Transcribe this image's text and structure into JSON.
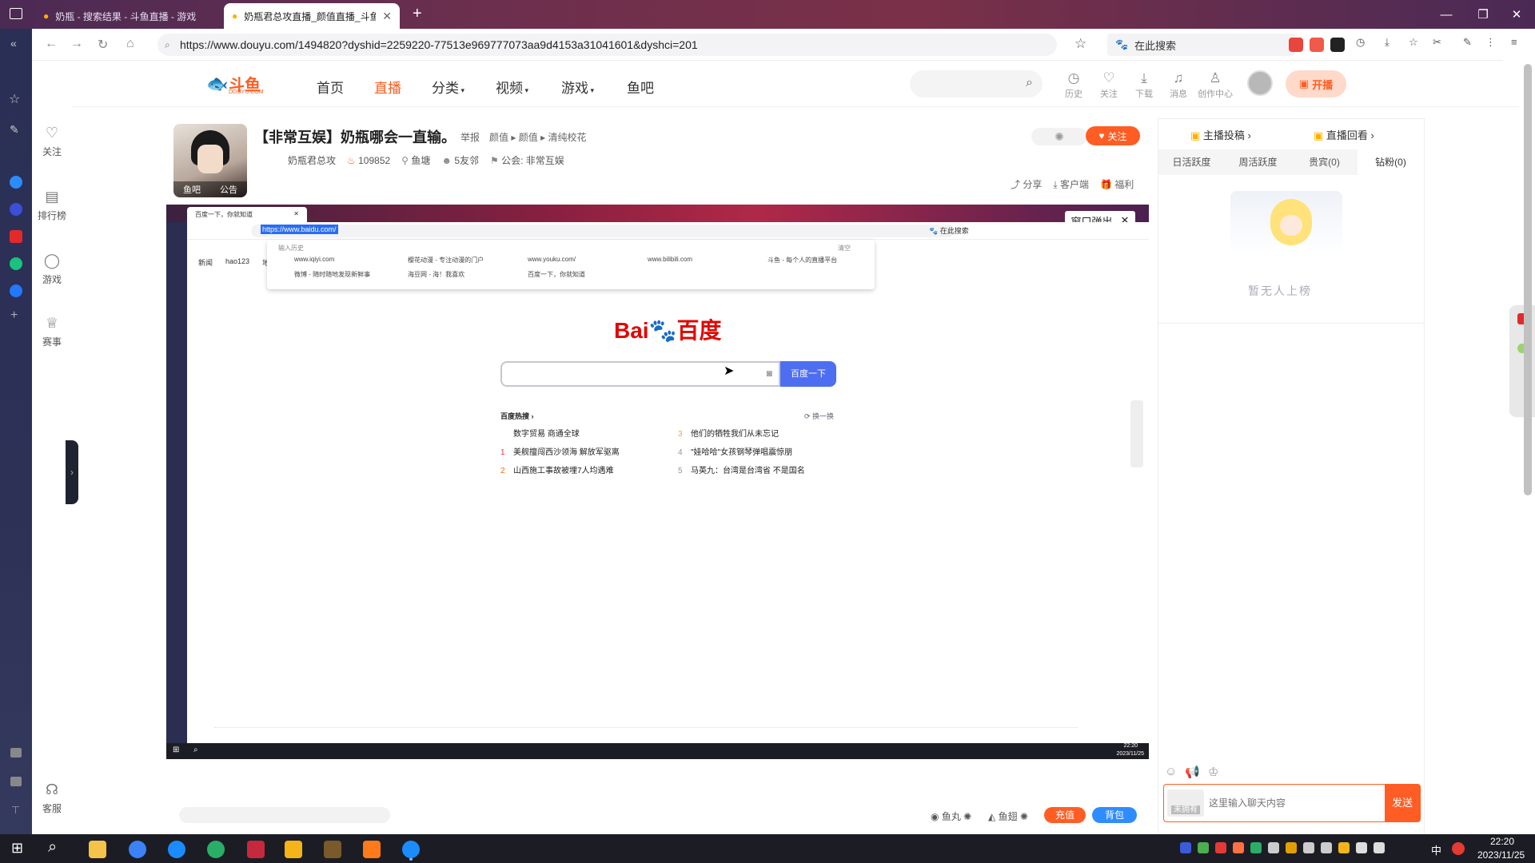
{
  "browser": {
    "tabs": [
      {
        "title": "奶瓶 - 搜索结果 - 斗鱼直播 - 游戏"
      },
      {
        "title": "奶瓶君总攻直播_颜值直播_斗鱼"
      }
    ],
    "url": "https://www.douyu.com/1494820?dyshid=2259220-77513e969777073aa9d4153a31041601&dyshci=201",
    "search_placeholder": "在此搜索"
  },
  "douyu": {
    "logo_text": "斗鱼",
    "logo_sub": "DOUYU.COM",
    "menu": [
      {
        "label": "首页",
        "active": false
      },
      {
        "label": "直播",
        "active": true
      },
      {
        "label": "分类",
        "dropdown": true
      },
      {
        "label": "视频",
        "dropdown": true
      },
      {
        "label": "游戏",
        "dropdown": true
      },
      {
        "label": "鱼吧",
        "active": false
      }
    ],
    "header_icons": [
      {
        "label": "历史",
        "icon": "clock-icon"
      },
      {
        "label": "关注",
        "icon": "heart-icon"
      },
      {
        "label": "下载",
        "icon": "download-icon"
      },
      {
        "label": "消息",
        "icon": "bell-icon"
      },
      {
        "label": "创作中心",
        "icon": "bulb-icon"
      }
    ],
    "start_live": "开播",
    "sidenav": [
      {
        "label": "关注",
        "icon": "heart-icon"
      },
      {
        "label": "排行榜",
        "icon": "rank-icon"
      },
      {
        "label": "游戏",
        "icon": "game-icon"
      },
      {
        "label": "赛事",
        "icon": "trophy-icon"
      },
      {
        "label": "客服",
        "icon": "headset-icon"
      }
    ],
    "room": {
      "title": "【非常互娱】奶瓶哪会一直输。",
      "report": "举报",
      "breadcrumb": [
        "颜值",
        "颜值",
        "清纯校花"
      ],
      "anchor": "奶瓶君总攻",
      "hot": "109852",
      "location": "鱼塘",
      "friends": "5友邻",
      "guild_label": "公会:",
      "guild": "非常互娱",
      "avatar_tabs": [
        "鱼吧",
        "公告"
      ],
      "follow": "关注",
      "actions": [
        "分享",
        "客户端",
        "福利"
      ]
    },
    "player": {
      "popup": "窗口弹出",
      "inner_tab": "百度一下，你就知道",
      "inner_url": "https://www.baidu.com/",
      "inner_search": "在此搜索",
      "history_label": "输入历史",
      "clear_label": "清空",
      "history": [
        "www.iqiyi.com",
        "樱花动漫 - 专注动漫的门户",
        "www.youku.com/",
        "www.bilibili.com",
        "斗鱼 - 每个人的直播平台",
        "微博 - 随时随地发现新鲜事",
        "海豆网 - 海！我喜欢",
        "百度一下，你就知道"
      ],
      "baidu_btn": "百度一下",
      "hot_title": "百度热搜",
      "hot_refresh": "换一换",
      "hot_left": [
        {
          "rank": "",
          "text": "数字贸易 商通全球"
        },
        {
          "rank": "1",
          "text": "美舰擅闯西沙领海 解放军驱离"
        },
        {
          "rank": "2",
          "text": "山西施工事故被埋7人均遇难"
        }
      ],
      "hot_right": [
        {
          "rank": "3",
          "text": "他们的牺牲我们从未忘记"
        },
        {
          "rank": "4",
          "text": "\"娃哈哈\"女孩钢琴弹唱震惊朋"
        },
        {
          "rank": "5",
          "text": "马英九：台湾是台湾省 不是国名"
        }
      ],
      "inner_nav": [
        "新闻",
        "hao123",
        "地"
      ],
      "inner_clock_time": "22:20",
      "inner_clock_date": "2023/11/25"
    },
    "footer": {
      "fishball": "鱼丸",
      "fishfin": "鱼翅",
      "recharge": "充值",
      "backpack": "背包"
    },
    "panel": {
      "top_links": [
        "主播投稿",
        "直播回看"
      ],
      "tabs": [
        "日活跃度",
        "周活跃度",
        "贵宾(0)",
        "钻粉(0)"
      ],
      "empty": "暂无人上榜",
      "chat_placeholder": "这里输入聊天内容",
      "send": "发送",
      "badge": "未拥有"
    }
  },
  "taskbar": {
    "time": "22:20",
    "date": "2023/11/25",
    "ime": "中"
  },
  "colors": {
    "accent": "#ff5d23",
    "baidu_blue": "#4e6ef2"
  }
}
